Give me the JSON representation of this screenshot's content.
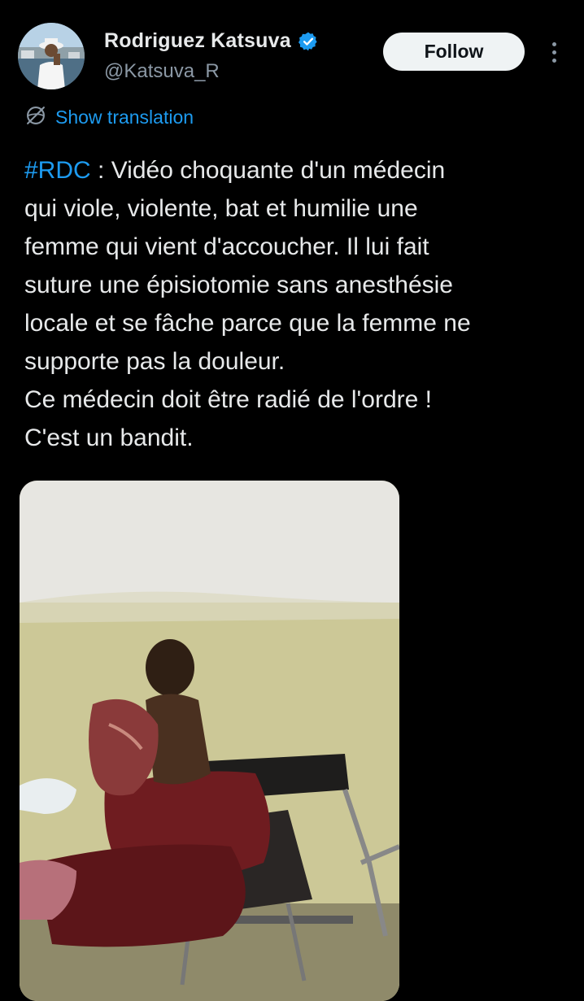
{
  "author": {
    "name": "Rodriguez Katsuva",
    "handle": "@Katsuva_R",
    "avatar_icon": "profile-photo",
    "verified_icon": "verified-badge-icon"
  },
  "actions": {
    "follow_label": "Follow",
    "more_icon": "more-options-icon"
  },
  "translation": {
    "label": "Show translation",
    "icon": "globe-icon"
  },
  "tweet": {
    "hashtag": "#RDC",
    "body": " : Vidéo choquante d'un médecin\nqui viole, violente, bat et humilie une\nfemme qui vient d'accoucher. Il lui fait\nsuture une épisiotomie sans anesthésie\nlocale et se fâche parce que la femme ne\nsupporte pas la douleur.\nCe médecin doit être radié de l'ordre !\nC'est un bandit."
  },
  "media": {
    "type": "video-thumbnail"
  },
  "colors": {
    "background": "#000000",
    "text_primary": "#e7e9ea",
    "text_secondary": "#8b98a5",
    "accent": "#1d9bf0",
    "follow_bg": "#eff3f4"
  }
}
